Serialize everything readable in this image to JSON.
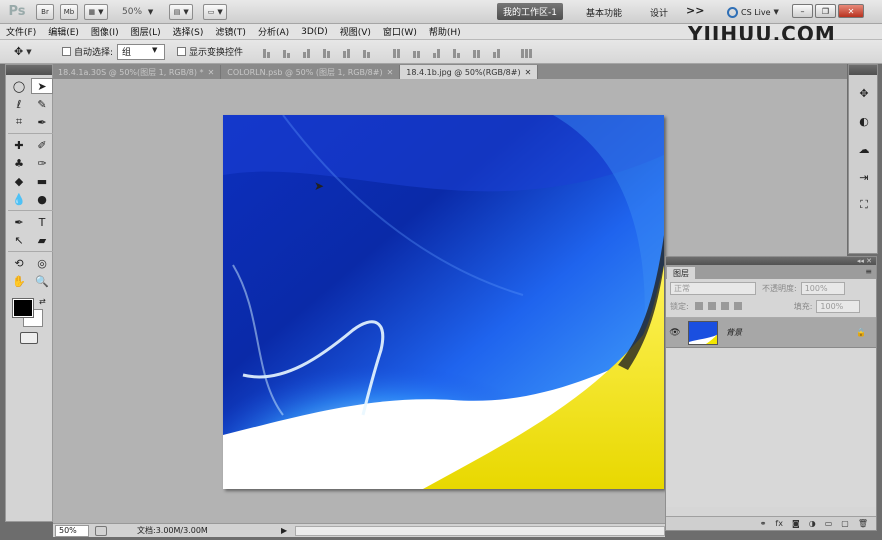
{
  "appbar": {
    "logo": "Ps",
    "btn_bridge": "Br",
    "btn_minibridge": "Mb",
    "zoom": "50%",
    "workspace_active": "我的工作区-1",
    "workspace_basic": "基本功能",
    "workspace_design": "设计",
    "more": ">>",
    "cs_live": "CS Live"
  },
  "watermark": "YIIHUU.COM",
  "menu": {
    "items": [
      "文件(F)",
      "编辑(E)",
      "图像(I)",
      "图层(L)",
      "选择(S)",
      "滤镜(T)",
      "分析(A)",
      "3D(D)",
      "视图(V)",
      "窗口(W)",
      "帮助(H)"
    ]
  },
  "options": {
    "auto_select_label": "自动选择:",
    "auto_select_value": "组",
    "show_transform_label": "显示变换控件"
  },
  "tabs": [
    {
      "label": "18.4.1a.30S @ 50%(图层 1, RGB/8) *",
      "active": false
    },
    {
      "label": "COLORLN.psb @ 50% (图层 1, RGB/8#)",
      "active": false
    },
    {
      "label": "18.4.1b.jpg @ 50%(RGB/8#)",
      "active": true
    }
  ],
  "status": {
    "zoom": "50%",
    "doc_info": "文档:3.00M/3.00M"
  },
  "layers_panel": {
    "tab_label": "图层",
    "blend_mode": "正常",
    "opacity_label": "不透明度:",
    "opacity_value": "100%",
    "lock_label": "锁定:",
    "fill_label": "填充:",
    "fill_value": "100%",
    "layer_name": "背景"
  },
  "colors": {
    "accent_blue": "#1a4fe0",
    "highlight_yellow": "#f2e600",
    "foreground": "#000000",
    "background": "#ffffff"
  }
}
